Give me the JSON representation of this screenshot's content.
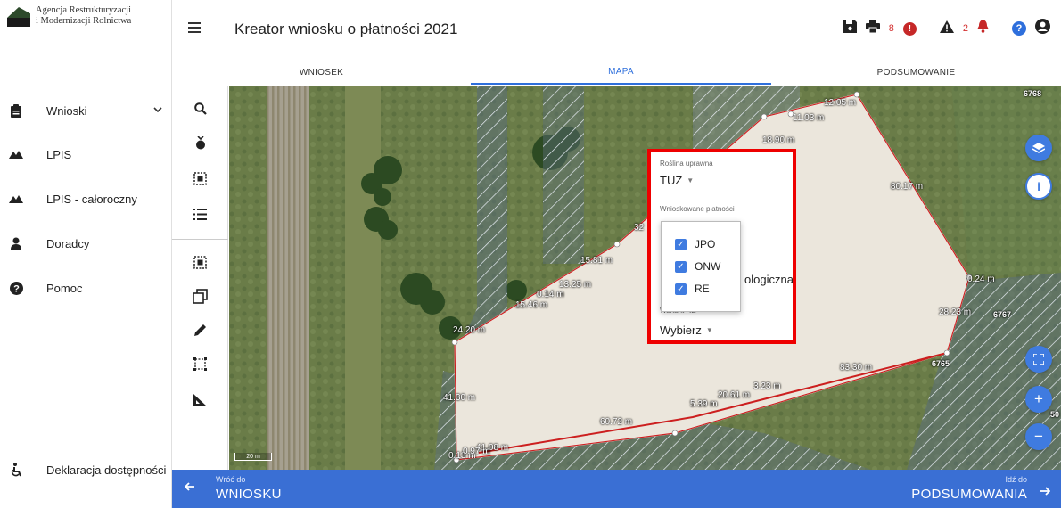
{
  "logo": {
    "line1": "Agencja Restrukturyzacji",
    "line2": "i Modernizacji Rolnictwa"
  },
  "sidebar": {
    "items": [
      {
        "label": "Wnioski",
        "icon": "clipboard-icon"
      },
      {
        "label": "LPIS",
        "icon": "mountains-icon"
      },
      {
        "label": "LPIS - całoroczny",
        "icon": "mountains-icon"
      },
      {
        "label": "Doradcy",
        "icon": "person-icon"
      },
      {
        "label": "Pomoc",
        "icon": "help-circle-icon"
      }
    ],
    "declaration": "Deklaracja dostępności"
  },
  "header": {
    "title": "Kreator wniosku o płatności 2021",
    "error_count": "8",
    "warning_count": "2"
  },
  "tabs": [
    {
      "label": "WNIOSEK",
      "active": false
    },
    {
      "label": "MAPA",
      "active": true
    },
    {
      "label": "PODSUMOWANIE",
      "active": false
    }
  ],
  "map": {
    "parcel_ids": [
      "6768",
      "6767",
      "6765"
    ],
    "measurements": [
      "12.05 m",
      "11.03 m",
      "18.90 m",
      "80.17 m",
      "32",
      "15.81 m",
      "13.25 m",
      "0.14 m",
      "15.46 m",
      "24.20 m",
      "0.24 m",
      "28.23 m",
      "83.30 m",
      "41.30 m",
      "3.23 m",
      "20.61 m",
      "5.39 m",
      "60.72 m",
      "41.08 m",
      "0.13 m",
      "0.97 m"
    ],
    "scale_label": "20 m",
    "edge_label": "50"
  },
  "popup": {
    "crop_label": "Roślina uprawna",
    "crop_value": "TUZ",
    "payments_label": "Wnioskowane płatności",
    "hidden_text": "ologiczna",
    "variant_label": "Wariant RE",
    "variant_value": "Wybierz",
    "options": [
      {
        "label": "JPO",
        "checked": true
      },
      {
        "label": "ONW",
        "checked": true
      },
      {
        "label": "RE",
        "checked": true
      }
    ]
  },
  "footer": {
    "back_small": "Wróć do",
    "back_big": "WNIOSKU",
    "next_small": "Idź do",
    "next_big": "PODSUMOWANIA"
  },
  "colors": {
    "accent": "#3a6fd4",
    "highlight": "#ee0000",
    "error": "#c62828"
  }
}
